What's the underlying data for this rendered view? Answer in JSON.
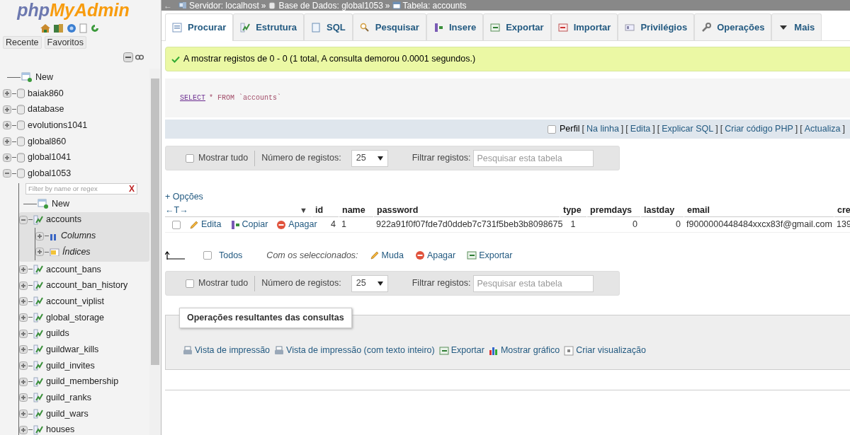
{
  "sidebar": {
    "logo": {
      "part_1": "php",
      "part_2": "MyAdmin"
    },
    "nav_tabs": [
      {
        "label": "Recente"
      },
      {
        "label": "Favoritos"
      }
    ],
    "tree": [
      {
        "kind": "new",
        "label": "New"
      },
      {
        "kind": "database",
        "label": "baiak860",
        "expanded": false
      },
      {
        "kind": "database",
        "label": "database",
        "expanded": false
      },
      {
        "kind": "database",
        "label": "evolutions1041",
        "expanded": false
      },
      {
        "kind": "database",
        "label": "global860",
        "expanded": false
      },
      {
        "kind": "database",
        "label": "global1041",
        "expanded": false
      },
      {
        "kind": "database",
        "label": "global1053",
        "expanded": true,
        "filter_placeholder": "Filter by name or regex",
        "filter_clear": "X",
        "children": [
          {
            "kind": "new",
            "label": "New"
          },
          {
            "kind": "table",
            "label": "accounts",
            "expanded": true,
            "selected": true,
            "children": [
              {
                "kind": "columns",
                "label": "Columns",
                "expanded": false
              },
              {
                "kind": "indexes",
                "label": "Índices",
                "expanded": false
              }
            ]
          },
          {
            "kind": "table",
            "label": "account_bans",
            "expanded": false,
            "selected": false
          },
          {
            "kind": "table",
            "label": "account_ban_history",
            "expanded": false,
            "selected": false
          },
          {
            "kind": "table",
            "label": "account_viplist",
            "expanded": false,
            "selected": false
          },
          {
            "kind": "table",
            "label": "global_storage",
            "expanded": false,
            "selected": false
          },
          {
            "kind": "table",
            "label": "guilds",
            "expanded": false,
            "selected": false
          },
          {
            "kind": "table",
            "label": "guildwar_kills",
            "expanded": false,
            "selected": false
          },
          {
            "kind": "table",
            "label": "guild_invites",
            "expanded": false,
            "selected": false
          },
          {
            "kind": "table",
            "label": "guild_membership",
            "expanded": false,
            "selected": false
          },
          {
            "kind": "table",
            "label": "guild_ranks",
            "expanded": false,
            "selected": false
          },
          {
            "kind": "table",
            "label": "guild_wars",
            "expanded": false,
            "selected": false
          },
          {
            "kind": "table",
            "label": "houses",
            "expanded": false,
            "selected": false
          }
        ]
      }
    ]
  },
  "breadcrumb": {
    "back": "←",
    "separator": "»",
    "items": [
      {
        "kind": "server",
        "text": "Servidor: localhost"
      },
      {
        "kind": "database",
        "text": "Base de Dados: global1053"
      },
      {
        "kind": "table",
        "text": "Tabela: accounts"
      }
    ]
  },
  "tabs": [
    {
      "kind": "browse",
      "label": "Procurar",
      "selected": true
    },
    {
      "kind": "structure",
      "label": "Estrutura",
      "selected": false
    },
    {
      "kind": "sql",
      "label": "SQL",
      "selected": false
    },
    {
      "kind": "search",
      "label": "Pesquisar",
      "selected": false
    },
    {
      "kind": "insert",
      "label": "Insere",
      "selected": false
    },
    {
      "kind": "export",
      "label": "Exportar",
      "selected": false
    },
    {
      "kind": "import",
      "label": "Importar",
      "selected": false
    },
    {
      "kind": "privileges",
      "label": "Privilégios",
      "selected": false
    },
    {
      "kind": "operations",
      "label": "Operações",
      "selected": false
    },
    {
      "kind": "more",
      "label": "Mais",
      "selected": false
    }
  ],
  "message": "A mostrar registos de 0 - 0 (1 total, A consulta demorou 0.0001 segundos.)",
  "sql": {
    "keyword": "SELECT",
    "rest": "* FROM `accounts`"
  },
  "query_bar": {
    "profile": {
      "label": "Perfil",
      "checked": false
    },
    "open": "[",
    "close": "]",
    "links": [
      "Na linha",
      "Edita",
      "Explicar SQL",
      "Criar código PHP",
      "Actualiza"
    ]
  },
  "nav_top": {
    "show_all": {
      "label": "Mostrar tudo",
      "checked": false
    },
    "rows_label": "Número de registos:",
    "rows_value": "25",
    "filter_label": "Filtrar registos:",
    "filter_placeholder": "Pesquisar esta tabela"
  },
  "options_link": "+ Opções",
  "table": {
    "resize_label": "←T→",
    "sort_arrow": "▼",
    "columns": [
      {
        "label": "id"
      },
      {
        "label": "name"
      },
      {
        "label": "password"
      },
      {
        "label": "type"
      },
      {
        "label": "premdays"
      },
      {
        "label": "lastday"
      },
      {
        "label": "email"
      },
      {
        "label": "cre"
      }
    ],
    "rows": [
      {
        "checked": false,
        "actions": [
          {
            "kind": "edit",
            "label": "Edita"
          },
          {
            "kind": "copy",
            "label": "Copiar"
          },
          {
            "kind": "delete",
            "label": "Apagar"
          }
        ],
        "cells": [
          "4",
          "1",
          "922a91f0f07fde7d0ddeb7c731f5beb3b8098675",
          "1",
          "0",
          "0",
          "f9000000448484xxcx83f@gmail.com",
          "139"
        ]
      }
    ]
  },
  "bulk": {
    "all": {
      "label": "Todos",
      "checked": false
    },
    "with_selected": "Com os seleccionados:",
    "actions": [
      {
        "kind": "edit",
        "label": "Muda"
      },
      {
        "kind": "delete",
        "label": "Apagar"
      },
      {
        "kind": "export",
        "label": "Exportar"
      }
    ]
  },
  "nav_bottom": {
    "show_all": {
      "label": "Mostrar tudo",
      "checked": false
    },
    "rows_label": "Número de registos:",
    "rows_value": "25",
    "filter_label": "Filtrar registos:",
    "filter_placeholder": "Pesquisar esta tabela"
  },
  "operations": {
    "legend": "Operações resultantes das consultas",
    "links": [
      {
        "kind": "print",
        "label": "Vista de impressão"
      },
      {
        "kind": "print",
        "label": "Vista de impressão (com texto inteiro)"
      },
      {
        "kind": "export",
        "label": "Exportar"
      },
      {
        "kind": "chart",
        "label": "Mostrar gráfico"
      },
      {
        "kind": "view",
        "label": "Criar visualização"
      }
    ]
  }
}
